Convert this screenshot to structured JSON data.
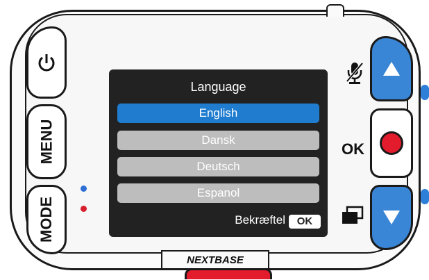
{
  "device": {
    "brand": "NEXTBASE",
    "side_buttons": [
      "MENU",
      "MODE"
    ],
    "ok_label": "OK"
  },
  "screen": {
    "title": "Language",
    "items": [
      {
        "label": "English",
        "selected": true
      },
      {
        "label": "Dansk",
        "selected": false
      },
      {
        "label": "Deutsch",
        "selected": false
      },
      {
        "label": "Espanol",
        "selected": false
      }
    ],
    "confirm_label": "Bekræftel",
    "confirm_key": "OK"
  },
  "colors": {
    "accent": "#1f7ccf",
    "nav_button": "#3a86d6",
    "record": "#e21b2d",
    "led_blue": "#2e6fd6",
    "led_red": "#d81f2d",
    "screen_bg": "#222222"
  },
  "icons": [
    "power-icon",
    "mute-mic-icon",
    "up-arrow-icon",
    "record-icon",
    "down-arrow-icon",
    "windows-icon"
  ]
}
